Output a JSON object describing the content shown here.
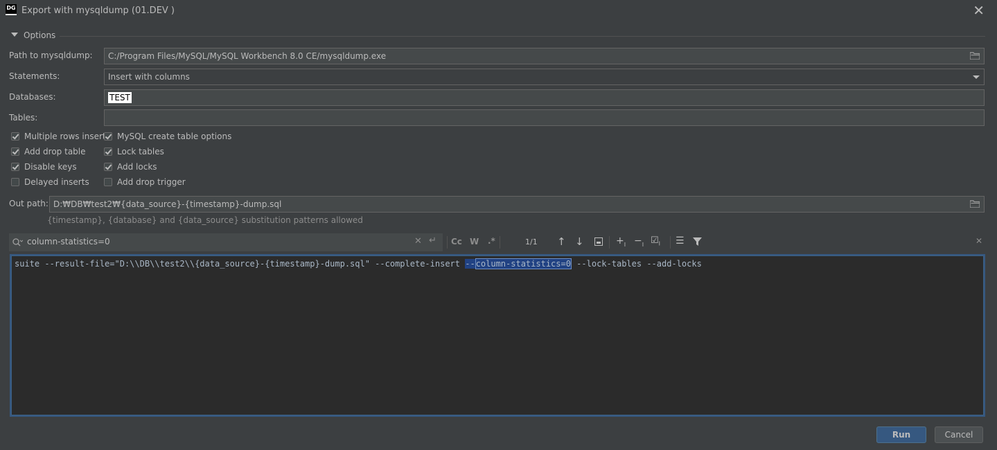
{
  "window": {
    "title": "Export with mysqldump (01.DEV        )",
    "logo_text": "DG"
  },
  "options": {
    "section_label": "Options",
    "path_label": "Path to mysqldump:",
    "path_value": "C:/Program Files/MySQL/MySQL Workbench 8.0 CE/mysqldump.exe",
    "statements_label": "Statements:",
    "statements_value": "Insert with columns",
    "databases_label": "Databases:",
    "databases_value": "TEST",
    "tables_label": "Tables:",
    "tables_value": "",
    "checkboxes": [
      {
        "label": "Multiple rows inserts",
        "checked": true
      },
      {
        "label": "MySQL create table options",
        "checked": true
      },
      {
        "label": "Add drop table",
        "checked": true
      },
      {
        "label": "Lock tables",
        "checked": true
      },
      {
        "label": "Disable keys",
        "checked": true
      },
      {
        "label": "Add locks",
        "checked": true
      },
      {
        "label": "Delayed inserts",
        "checked": false
      },
      {
        "label": "Add drop trigger",
        "checked": false
      }
    ],
    "out_path_label": "Out path:",
    "out_path_value": "D:₩DB₩test2₩{data_source}-{timestamp}-dump.sql",
    "out_path_hint": "{timestamp}, {database} and {data_source} substitution patterns allowed"
  },
  "find": {
    "query": "column-statistics=0",
    "match_count": "1/1",
    "opt_case": "Cc",
    "opt_word": "W",
    "opt_regex": ".*"
  },
  "editor": {
    "before": "suite --result-file=\"D:\\\\DB\\\\test2\\\\{data_source}-{timestamp}-dump.sql\" --complete-insert ",
    "match_prefix": "--",
    "match": "column-statistics=0",
    "after": " --lock-tables --add-locks"
  },
  "buttons": {
    "run": "Run",
    "cancel": "Cancel"
  },
  "colors": {
    "background": "#3c3f41",
    "editor_bg": "#2b2b2b",
    "accent": "#365880",
    "selection": "#214283"
  }
}
